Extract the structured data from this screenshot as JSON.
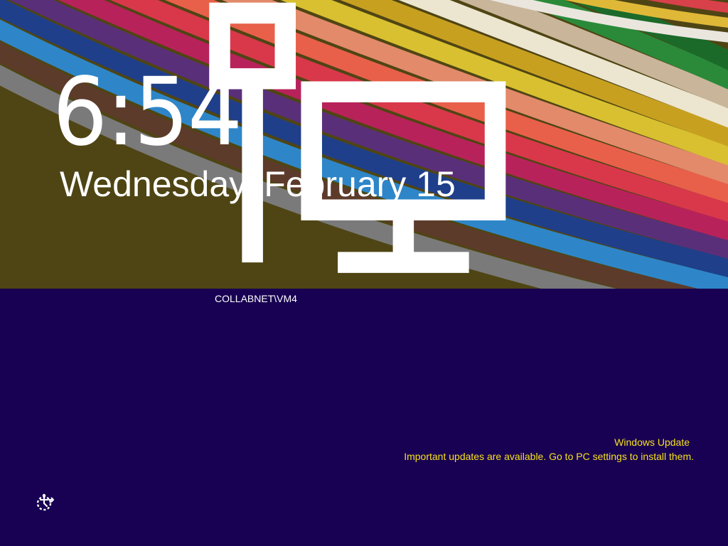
{
  "lock_screen": {
    "time": "6:54",
    "date": "Wednesday, February 15",
    "network_icon": "network-wired-icon"
  },
  "login": {
    "username": "COLLABNET\\VM4",
    "ease_of_access_icon": "ease-of-access-icon"
  },
  "notification": {
    "title": "Windows Update",
    "message": "Important updates are available. Go to PC settings to install them."
  },
  "colors": {
    "login_background": "#180052",
    "notification_text": "#f5e21c",
    "text": "#ffffff"
  }
}
